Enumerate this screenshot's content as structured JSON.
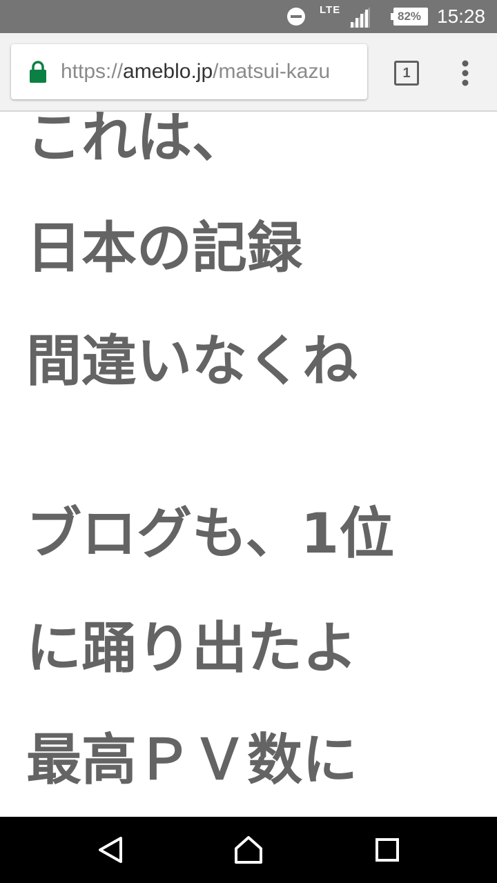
{
  "status_bar": {
    "network": "LTE",
    "battery": "82%",
    "time": "15:28"
  },
  "browser": {
    "url_scheme": "https://",
    "url_domain": "ameblo.jp",
    "url_path": "/matsui-kazu",
    "tab_count": "1"
  },
  "content": {
    "lines": [
      "これは、",
      "日本の記録",
      "間違いなくね",
      "ブログも、1位",
      "に踊り出たよ",
      "最高ＰＶ数に"
    ]
  },
  "colors": {
    "status_bar": "#757575",
    "toolbar": "#f2f2f2",
    "lock": "#0b8043",
    "text": "#646464"
  },
  "icons": {
    "dnd": "do-not-disturb-icon",
    "signal": "signal-icon",
    "battery": "battery-icon",
    "lock": "lock-icon",
    "tabs": "tab-switcher-icon",
    "menu": "more-vert-icon",
    "back": "back-icon",
    "home": "home-icon",
    "recents": "recents-icon"
  }
}
